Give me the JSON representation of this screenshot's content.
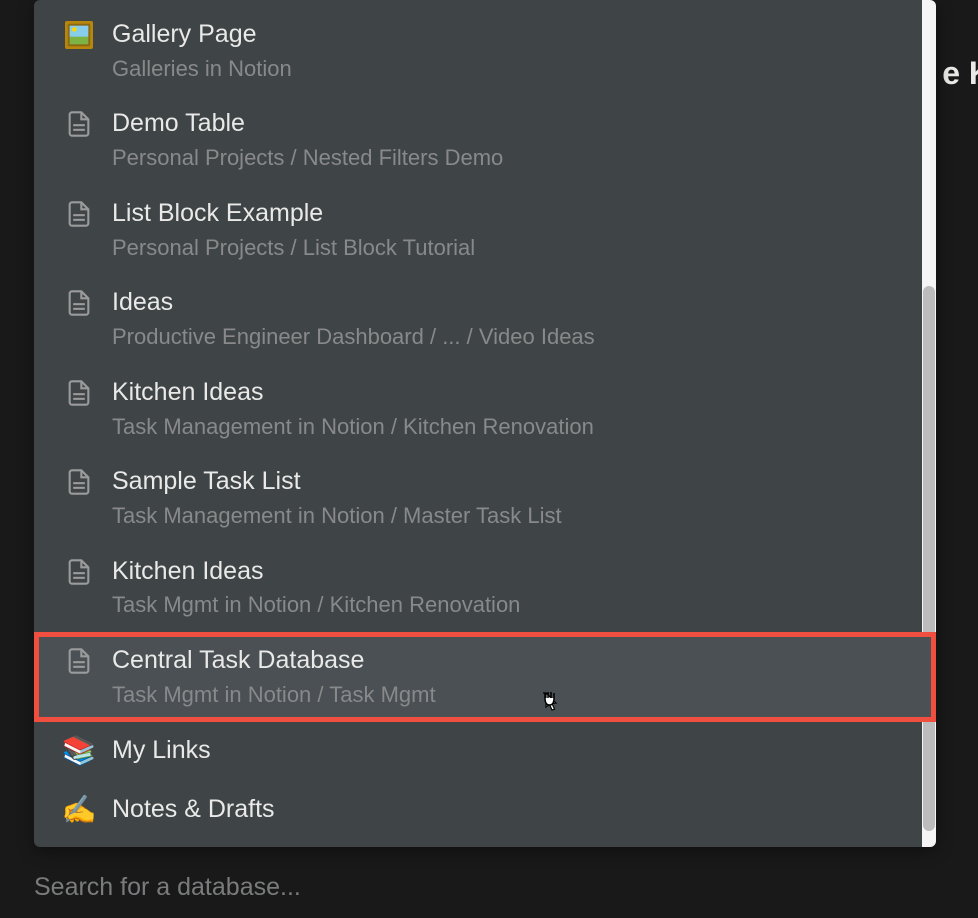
{
  "overflow_text": "e K",
  "search": {
    "placeholder": "Search for a database..."
  },
  "items": [
    {
      "title": "Gallery Page",
      "subtitle": "Galleries in Notion",
      "icon_type": "picture"
    },
    {
      "title": "Demo Table",
      "subtitle": "Personal Projects / Nested Filters Demo",
      "icon_type": "page"
    },
    {
      "title": "List Block Example",
      "subtitle": "Personal Projects / List Block Tutorial",
      "icon_type": "page"
    },
    {
      "title": "Ideas",
      "subtitle": "Productive Engineer Dashboard / ... / Video Ideas",
      "icon_type": "page"
    },
    {
      "title": "Kitchen Ideas",
      "subtitle": "Task Management in Notion / Kitchen Renovation",
      "icon_type": "page"
    },
    {
      "title": "Sample Task List",
      "subtitle": "Task Management in Notion / Master Task List",
      "icon_type": "page"
    },
    {
      "title": "Kitchen Ideas",
      "subtitle": "Task Mgmt in Notion / Kitchen Renovation",
      "icon_type": "page"
    },
    {
      "title": "Central Task Database",
      "subtitle": "Task Mgmt in Notion / Task Mgmt",
      "icon_type": "page",
      "highlighted": true,
      "hovered": true
    },
    {
      "title": "My Links",
      "subtitle": "",
      "icon_type": "books"
    },
    {
      "title": "Notes & Drafts",
      "subtitle": "",
      "icon_type": "writing"
    }
  ]
}
